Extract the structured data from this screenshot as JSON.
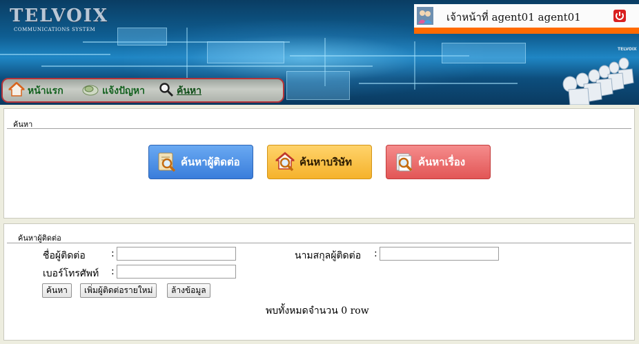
{
  "header": {
    "logo_text": "TELVOIX",
    "logo_subtitle": "COMMUNICATIONS SYSTEM",
    "user_label": "เจ้าหน้าที่ agent01 agent01",
    "corner_logo": "TELVOIX"
  },
  "nav": {
    "items": [
      {
        "label": "หน้าแรก",
        "icon": "home-icon"
      },
      {
        "label": "แจ้งปัญหา",
        "icon": "report-icon"
      },
      {
        "label": "ค้นหา",
        "icon": "search-icon",
        "active": true
      }
    ]
  },
  "search_panel": {
    "title": "ค้นหา",
    "buttons": [
      {
        "label": "ค้นหาผู้ติดต่อ",
        "color": "#3a7ddb"
      },
      {
        "label": "ค้นหาบริษัท",
        "color": "#f5b22b"
      },
      {
        "label": "ค้นหาเรื่อง",
        "color": "#e25656"
      }
    ]
  },
  "contact_panel": {
    "title": "ค้นหาผู้ติดต่อ",
    "fields": {
      "first_name_label": "ชื่อผู้ติดต่อ",
      "first_name_value": "",
      "last_name_label": "นามสกุลผู้ติดต่อ",
      "last_name_value": "",
      "phone_label": "เบอร์โทรศัพท์",
      "phone_value": "",
      "colon": ":"
    },
    "actions": {
      "search": "ค้นหา",
      "add_new": "เพิ่มผู้ติดต่อรายใหม่",
      "clear": "ล้างข้อมูล"
    },
    "result_text": "พบทั้งหมดจำนวน 0 row"
  },
  "colors": {
    "accent_orange": "#ff6a00",
    "nav_border": "#b63338",
    "nav_text": "#13611f"
  }
}
